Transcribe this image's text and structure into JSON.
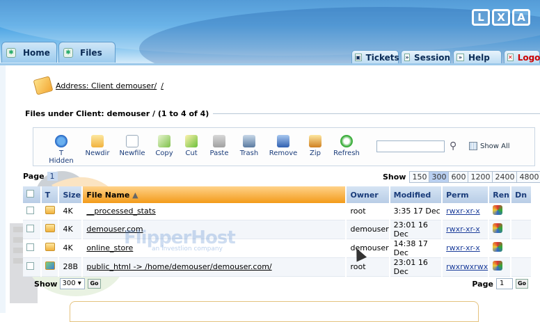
{
  "brand": {
    "logo": [
      "L",
      "X",
      "A"
    ]
  },
  "tabs": {
    "left": [
      {
        "label": "Home"
      },
      {
        "label": "Files"
      }
    ],
    "right": [
      {
        "label": "Tickets"
      },
      {
        "label": "Session"
      },
      {
        "label": "Help"
      },
      {
        "label": "Logou"
      }
    ]
  },
  "address": {
    "prefix": "Address: Client demouser/",
    "suffix": "/"
  },
  "section_title": "Files under Client: demouser / (1 to 4 of 4)",
  "toolbar": {
    "buttons": [
      {
        "label": "T Hidden",
        "icon": "eye-refresh-icon"
      },
      {
        "label": "Newdir",
        "icon": "new-folder-icon"
      },
      {
        "label": "Newfile",
        "icon": "new-file-icon"
      },
      {
        "label": "Copy",
        "icon": "copy-icon"
      },
      {
        "label": "Cut",
        "icon": "cut-icon"
      },
      {
        "label": "Paste",
        "icon": "paste-icon"
      },
      {
        "label": "Trash",
        "icon": "trash-icon"
      },
      {
        "label": "Remove",
        "icon": "remove-icon"
      },
      {
        "label": "Zip",
        "icon": "zip-icon"
      },
      {
        "label": "Refresh",
        "icon": "refresh-icon"
      }
    ],
    "search_value": "",
    "show_all_label": "Show All"
  },
  "pager_top": {
    "label": "Page",
    "current": "1"
  },
  "show_top": {
    "label": "Show",
    "options": [
      "150",
      "300",
      "600",
      "1200",
      "2400",
      "4800"
    ],
    "selected": "300"
  },
  "table": {
    "headers": {
      "t": "T",
      "size": "Size",
      "name": "File Name",
      "owner": "Owner",
      "modified": "Modified",
      "perm": "Perm",
      "ren": "Ren",
      "dn": "Dn"
    },
    "rows": [
      {
        "size": "4K",
        "name": "__processed_stats",
        "owner": "root",
        "modified": "3:35 17 Dec",
        "perm": "rwxr-xr-x",
        "type": "folder"
      },
      {
        "size": "4K",
        "name": "demouser.com",
        "owner": "demouser",
        "modified": "23:01 16 Dec",
        "perm": "rwxr-xr-x",
        "type": "folder"
      },
      {
        "size": "4K",
        "name": "online_store",
        "owner": "demouser",
        "modified": "14:38 17 Dec",
        "perm": "rwxr-xr-x",
        "type": "folder"
      },
      {
        "size": "28B",
        "name": "public_html -> /home/demouser/demouser.com/",
        "owner": "root",
        "modified": "23:01 16 Dec",
        "perm": "rwxrwxrwx",
        "type": "link"
      }
    ]
  },
  "bottom": {
    "show_label": "Show",
    "show_value": "300",
    "go": "Go",
    "page_label": "Page",
    "page_value": "1"
  },
  "watermark": {
    "title": "FlipperHost",
    "subtitle": "an investlion company"
  }
}
